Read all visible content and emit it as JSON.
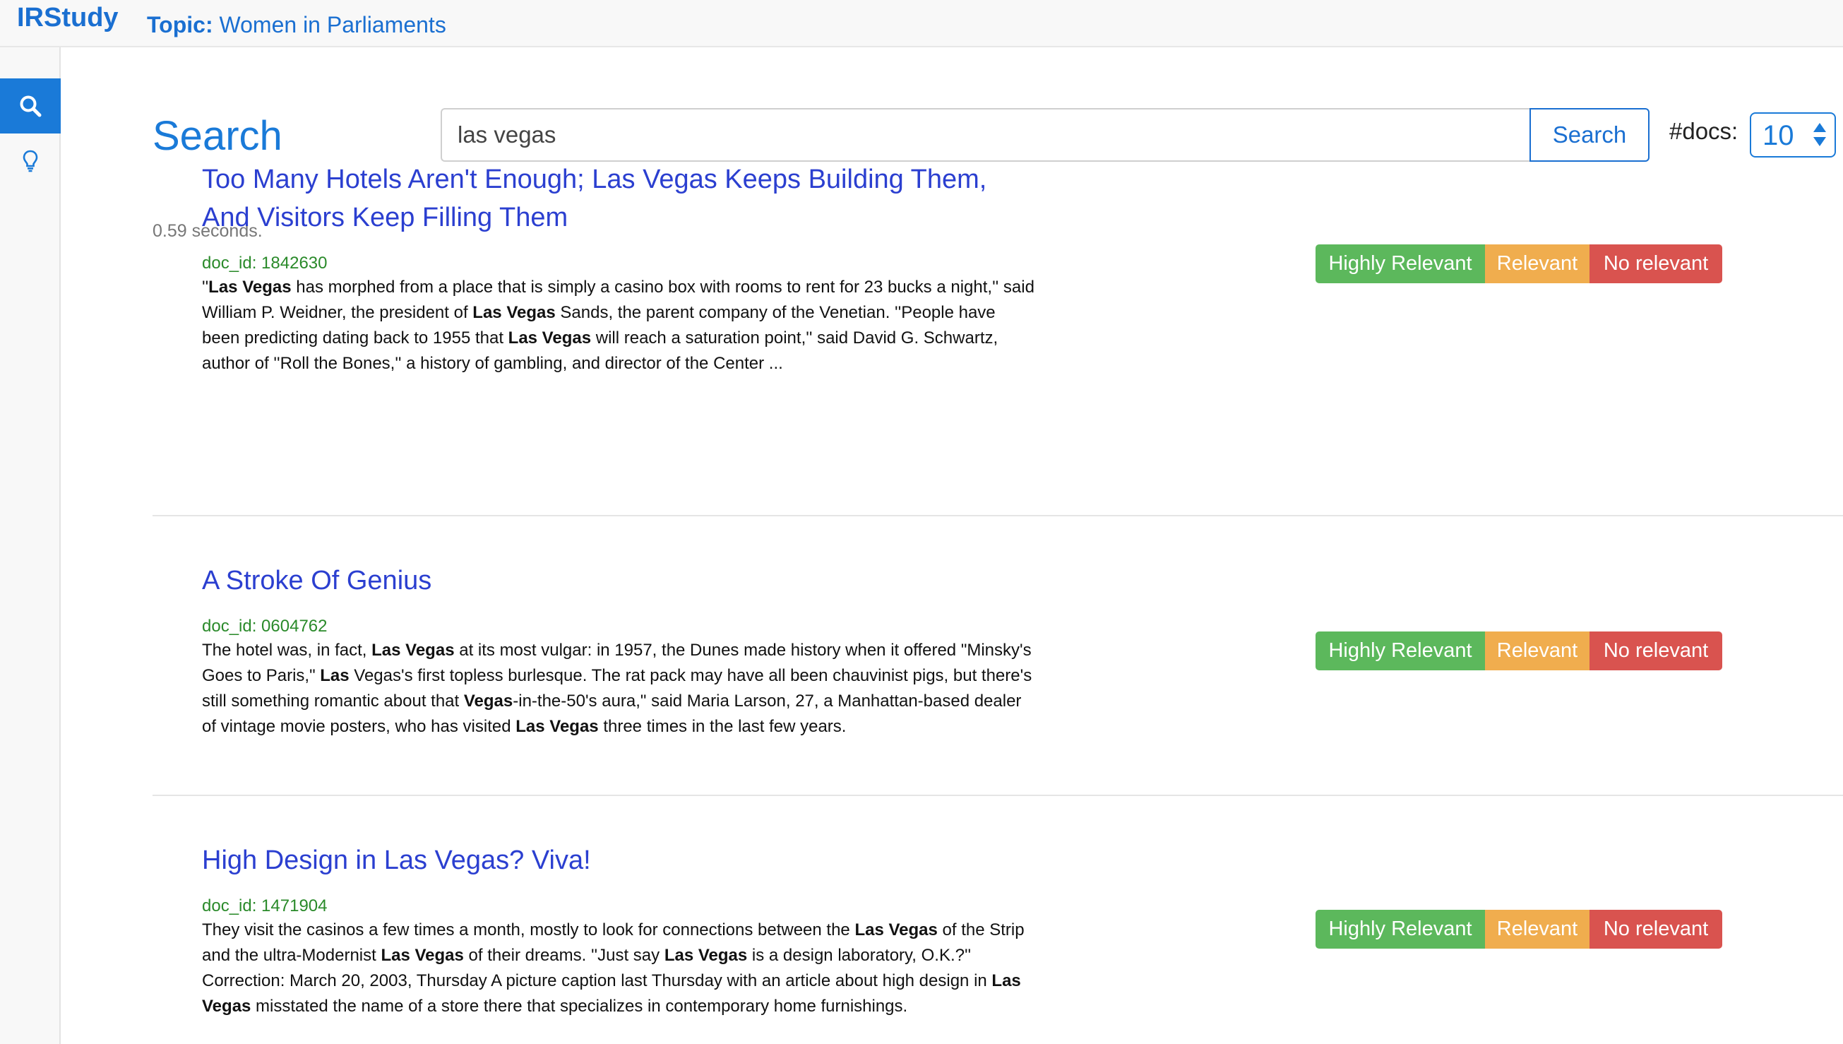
{
  "navbar": {
    "brand": "IRStudy",
    "topic_key": "Topic:",
    "topic_value": "Women in Parliaments"
  },
  "sidebar": {
    "items": [
      {
        "icon": "search-icon",
        "active": true
      },
      {
        "icon": "lightbulb-icon",
        "active": false
      }
    ]
  },
  "search": {
    "page_title": "Search",
    "query": "las vegas",
    "button_label": "Search",
    "docs_label": "#docs:",
    "docs_value": "10",
    "timing": "0.59 seconds."
  },
  "rating_labels": {
    "high": "Highly Relevant",
    "relevant": "Relevant",
    "none": "No relevant"
  },
  "colors": {
    "accent": "#1a7ad8",
    "highly_relevant": "#5cb85c",
    "relevant": "#f0ad4e",
    "no_relevant": "#d9534f",
    "title_link": "#2b3fd0",
    "doc_id": "#2a8a2a"
  },
  "results": [
    {
      "title": "Too Many Hotels Aren't Enough; Las Vegas Keeps Building Them, And Visitors Keep Filling Them",
      "doc_id": "doc_id: 1842630",
      "snippet": "''<b>Las Vegas</b> has morphed from a place that is simply a casino box with rooms to rent for 23 bucks a night,'' said William P. Weidner, the president of <b>Las Vegas</b> Sands, the parent company of the Venetian. ''People have been predicting dating back to 1955 that <b>Las Vegas</b> will reach a saturation point,'' said David G. Schwartz, author of ''Roll the Bones,'' a history of gambling, and director of the Center ..."
    },
    {
      "title": "A Stroke Of Genius",
      "doc_id": "doc_id: 0604762",
      "snippet": "The hotel was, in fact, <b>Las Vegas</b> at its most vulgar: in 1957, the Dunes made history when it offered \"Minsky's Goes to Paris,\" <b>Las</b> Vegas's first topless burlesque. The rat pack may have all been chauvinist pigs, but there's still something romantic about that <b>Vegas</b>-in-the-50's aura,\" said Maria Larson, 27, a Manhattan-based dealer of vintage movie posters, who has visited <b>Las Vegas</b> three times in the last few years."
    },
    {
      "title": "High Design in Las Vegas? Viva!",
      "doc_id": "doc_id: 1471904",
      "snippet": "They visit the casinos a few times a month, mostly to look for connections between the <b>Las Vegas</b> of the Strip and the ultra-Modernist <b>Las Vegas</b> of their dreams. ''Just say <b>Las Vegas</b> is a design laboratory, O.K.?'' Correction: March 20, 2003, Thursday A picture caption last Thursday with an article about high design in <b>Las Vegas</b> misstated the name of a store there that specializes in contemporary home furnishings."
    }
  ]
}
